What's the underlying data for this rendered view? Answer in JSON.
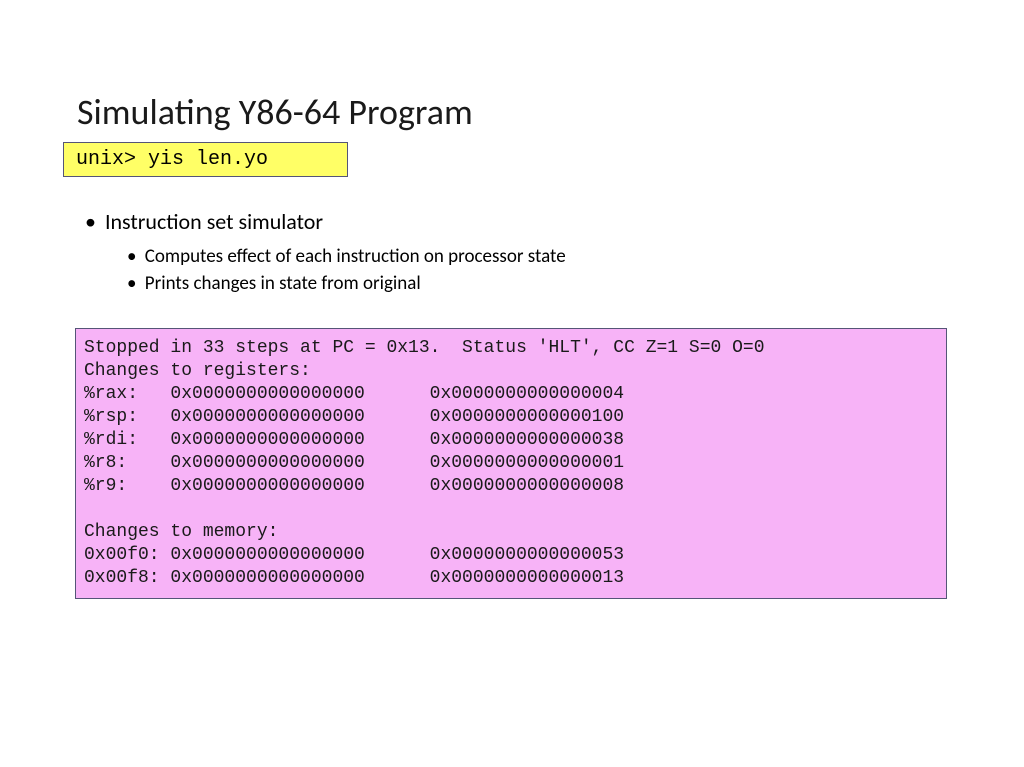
{
  "title": "Simulating Y86-64 Program",
  "command": "unix> yis len.yo",
  "bullets": {
    "main": "Instruction set simulator",
    "sub1": "Computes effect of each instruction on processor state",
    "sub2": "Prints changes in state from original"
  },
  "output": "Stopped in 33 steps at PC = 0x13.  Status 'HLT', CC Z=1 S=0 O=0\nChanges to registers:\n%rax:   0x0000000000000000      0x0000000000000004\n%rsp:   0x0000000000000000      0x0000000000000100\n%rdi:   0x0000000000000000      0x0000000000000038\n%r8:    0x0000000000000000      0x0000000000000001\n%r9:    0x0000000000000000      0x0000000000000008\n\nChanges to memory:\n0x00f0: 0x0000000000000000      0x0000000000000053\n0x00f8: 0x0000000000000000      0x0000000000000013"
}
